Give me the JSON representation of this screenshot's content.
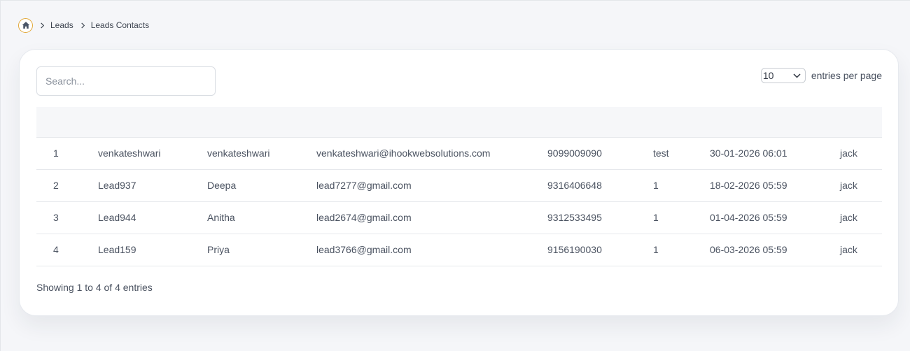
{
  "breadcrumb": {
    "home_icon": "home-icon",
    "items": [
      "Leads",
      "Leads Contacts"
    ]
  },
  "search": {
    "placeholder": "Search...",
    "value": ""
  },
  "pagination": {
    "per_page_value": "10",
    "per_page_label": "entries per page"
  },
  "table": {
    "headers": [
      "",
      "",
      "",
      "",
      "",
      "",
      "",
      ""
    ],
    "rows": [
      [
        "1",
        "venkateshwari",
        "venkateshwari",
        "venkateshwari@ihookwebsolutions.com",
        "9099009090",
        "test",
        "30-01-2026 06:01",
        "jack"
      ],
      [
        "2",
        "Lead937",
        "Deepa",
        "lead7277@gmail.com",
        "9316406648",
        "1",
        "18-02-2026 05:59",
        "jack"
      ],
      [
        "3",
        "Lead944",
        "Anitha",
        "lead2674@gmail.com",
        "9312533495",
        "1",
        "01-04-2026 05:59",
        "jack"
      ],
      [
        "4",
        "Lead159",
        "Priya",
        "lead3766@gmail.com",
        "9156190030",
        "1",
        "06-03-2026 05:59",
        "jack"
      ]
    ]
  },
  "footer": {
    "info": "Showing 1 to 4 of 4 entries"
  },
  "colors": {
    "accent": "#e2a93c",
    "home_icon": "#4a5568",
    "card_bg": "#ffffff",
    "page_bg": "#f5f6f9"
  }
}
